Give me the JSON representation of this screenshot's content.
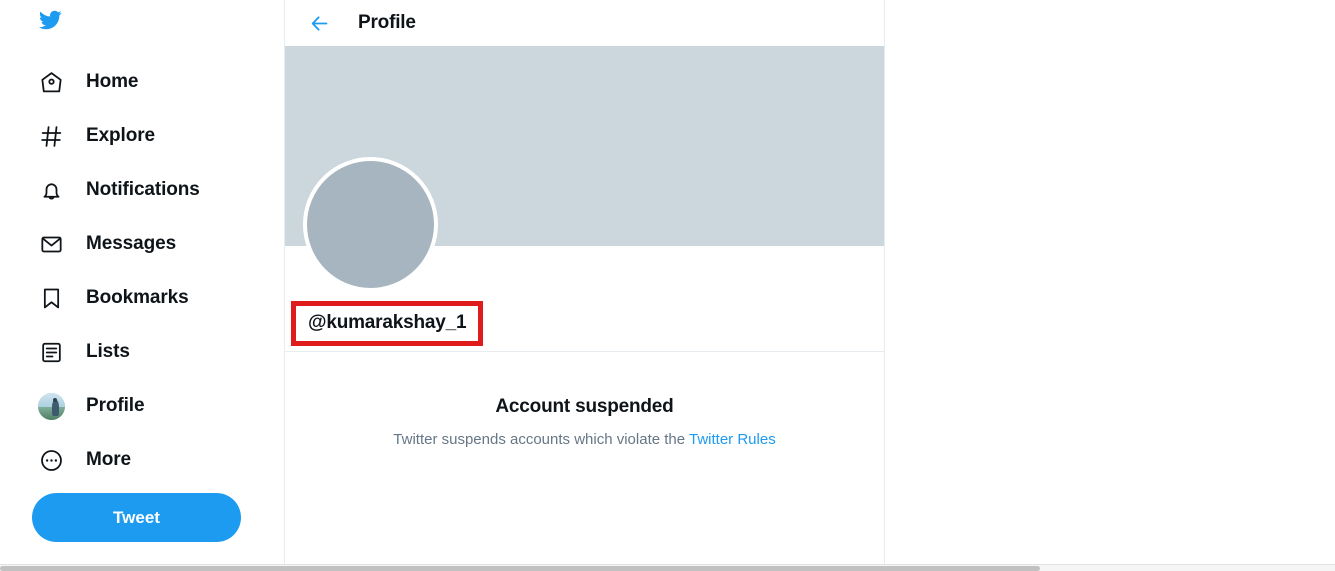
{
  "brand": {
    "logo_icon": "twitter-bird-icon",
    "accent_color": "#1d9bf0"
  },
  "sidebar": {
    "items": [
      {
        "label": "Home",
        "icon": "home-icon"
      },
      {
        "label": "Explore",
        "icon": "hashtag-icon"
      },
      {
        "label": "Notifications",
        "icon": "bell-icon"
      },
      {
        "label": "Messages",
        "icon": "envelope-icon"
      },
      {
        "label": "Bookmarks",
        "icon": "bookmark-icon"
      },
      {
        "label": "Lists",
        "icon": "list-icon"
      },
      {
        "label": "Profile",
        "icon": "user-avatar-photo-icon"
      },
      {
        "label": "More",
        "icon": "more-circle-icon"
      }
    ],
    "tweet_button_label": "Tweet"
  },
  "header": {
    "back_icon": "arrow-left-icon",
    "title": "Profile"
  },
  "profile": {
    "banner_color": "#ccd6dd",
    "avatar_color": "#a6b5bf",
    "handle": "@kumarakshay_1",
    "handle_highlight_color": "#e01b1b"
  },
  "suspended": {
    "title": "Account suspended",
    "description_prefix": "Twitter suspends accounts which violate the ",
    "link_label": "Twitter Rules",
    "link_color": "#1d9bf0",
    "text_color": "#657786"
  }
}
